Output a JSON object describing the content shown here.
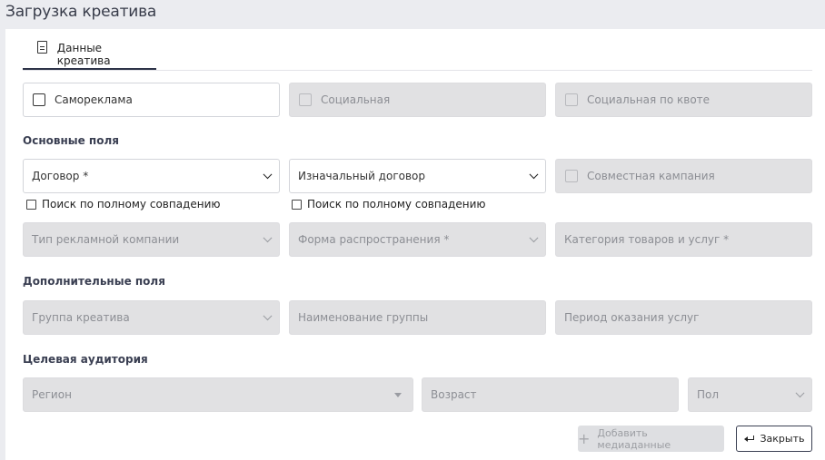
{
  "window": {
    "title": "Загрузка креатива"
  },
  "tabs": [
    {
      "label": "Данные креатива",
      "icon": "document-icon"
    }
  ],
  "type_row": {
    "self_promo": "Самореклама",
    "social": "Социальная",
    "social_quota": "Социальная по квоте"
  },
  "sections": {
    "main": "Основные поля",
    "extra": "Дополнительные поля",
    "audience": "Целевая аудитория"
  },
  "main_fields": {
    "contract": "Договор *",
    "initial_contract": "Изначальный договор",
    "joint_campaign": "Совместная кампания",
    "exact_match_label": "Поиск по полному совпадению",
    "campaign_type": "Тип рекламной компании",
    "distribution_form": "Форма распространения *",
    "goods_category": "Категория товаров и услуг *"
  },
  "extra_fields": {
    "creative_group": "Группа креатива",
    "group_name": "Наименование группы",
    "service_period": "Период оказания услуг"
  },
  "audience_fields": {
    "region": "Регион",
    "age": "Возраст",
    "gender": "Пол"
  },
  "buttons": {
    "add_media": "Добавить медиаданные",
    "close": "Закрыть"
  }
}
